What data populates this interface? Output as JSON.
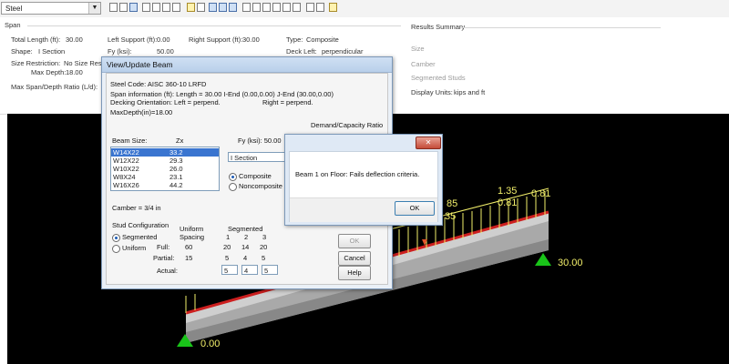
{
  "toolbar": {
    "material_select": "Steel",
    "dropdown_arrow": "▼"
  },
  "span_section": {
    "header": "Span",
    "total_length_label": "Total Length (ft):",
    "total_length_value": "30.00",
    "left_support_label": "Left Support (ft):",
    "left_support_value": "0.00",
    "right_support_label": "Right Support (ft):",
    "right_support_value": "30.00",
    "type_label": "Type:",
    "type_value": "Composite",
    "shape_label": "Shape:",
    "shape_value": "I Section",
    "fy_label": "Fy (ksi):",
    "fy_value": "50.00",
    "deck_left_label": "Deck Left:",
    "deck_left_value": "perpendicular",
    "size_restriction_label": "Size Restriction:",
    "size_restriction_value": "No Size Rest",
    "max_depth_label": "Max Depth:",
    "max_depth_value": "18.00",
    "max_span_depth_label": "Max Span/Depth Ratio (L/d):"
  },
  "results_summary": {
    "header": "Results Summary",
    "size_label": "Size",
    "camber_label": "Camber",
    "segmented_studs_label": "Segmented Studs",
    "display_units_label": "Display Units:",
    "display_units_value": "kips and ft"
  },
  "beam_dialog": {
    "title": "View/Update Beam",
    "steel_code": "Steel Code: AISC 360-10 LRFD",
    "span_info": "Span information (ft): Length = 30.00 I-End (0.00,0.00) J-End (30.00,0.00)",
    "decking_orientation": "Decking Orientation: Left = perpend.",
    "decking_right": "Right = perpend.",
    "max_depth": "MaxDepth(in)=18.00",
    "dc_ratio_label": "Demand/Capacity Ratio",
    "beam_size_label": "Beam Size:",
    "zx_label": "Zx",
    "fy_label": "Fy (ksi): 50.00",
    "sections": [
      {
        "name": "W14X22",
        "zx": "33.2"
      },
      {
        "name": "W12X22",
        "zx": "29.3"
      },
      {
        "name": "W10X22",
        "zx": "26.0"
      },
      {
        "name": "W8X24",
        "zx": "23.1"
      },
      {
        "name": "W16X26",
        "zx": "44.2"
      }
    ],
    "shape_select": "I Section",
    "composite_label": "Composite",
    "noncomposite_label": "Noncomposite",
    "camber": "Camber = 3/4 in",
    "stud_config_label": "Stud Configuration",
    "segmented_label": "Segmented",
    "uniform_label": "Uniform",
    "uniform_spacing_header_1": "Uniform",
    "uniform_spacing_header_2": "Spacing",
    "segmented_header": "Segmented",
    "seg_cols": [
      "1",
      "2",
      "3"
    ],
    "full_label": "Full:",
    "full_uniform": "60",
    "full_values": [
      "20",
      "14",
      "20"
    ],
    "partial_label": "Partial:",
    "partial_uniform": "15",
    "partial_values": [
      "5",
      "4",
      "5"
    ],
    "actual_label": "Actual:",
    "actual_values": [
      "5",
      "4",
      "5"
    ],
    "ok_button": "OK",
    "cancel_button": "Cancel",
    "help_button": "Help"
  },
  "message_box": {
    "message": "Beam 1 on Floor:  Fails deflection criteria.",
    "ok_button": "OK",
    "close_glyph": "✕"
  },
  "canvas": {
    "left_support": "0.00",
    "right_support": "30.00",
    "load_label_1": "1.35",
    "load_label_2": "0.81",
    "load_label_3": "0.81",
    "load_label_4": "85",
    "load_label_5": "35",
    "load_color": "#f2ef6a",
    "beam_top_color": "#cc1f1f",
    "support_color": "#19c419"
  }
}
